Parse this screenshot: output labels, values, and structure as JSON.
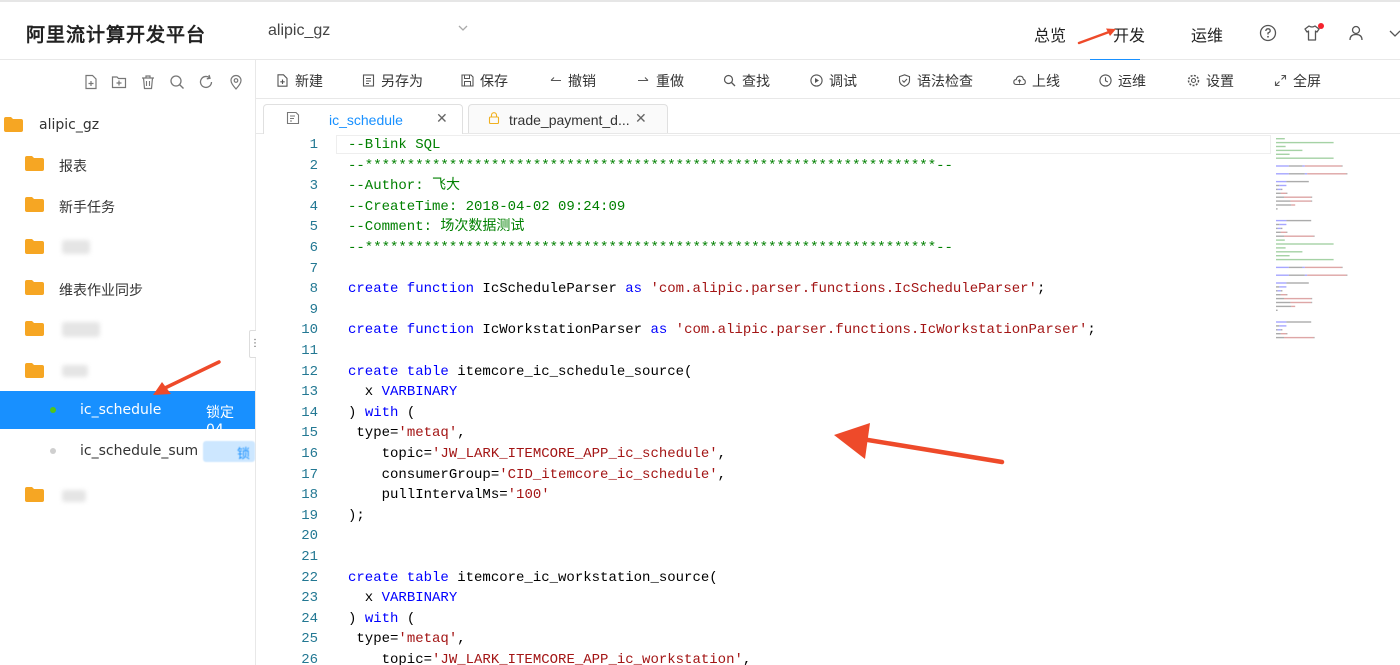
{
  "app": {
    "title": "阿里流计算开发平台"
  },
  "project": {
    "selected": "alipic_gz"
  },
  "topnav": {
    "items": [
      "总览",
      "开发",
      "运维"
    ],
    "active": "开发"
  },
  "sidebar": {
    "root": "alipic_gz",
    "items": [
      {
        "label": "报表"
      },
      {
        "label": "新手任务"
      },
      {
        "label": ""
      },
      {
        "label": "维表作业同步"
      },
      {
        "label": ""
      },
      {
        "label": ""
      }
    ],
    "jobs": [
      {
        "label": "ic_schedule",
        "lock": "锁定 04",
        "status_color": "#52c41a"
      },
      {
        "label": "ic_schedule_sum",
        "lock": "锁",
        "status_color": "#cfcfcf"
      }
    ]
  },
  "toolbar": {
    "new": "新建",
    "save_as": "另存为",
    "save": "保存",
    "undo": "撤销",
    "redo": "重做",
    "find": "查找",
    "debug": "调试",
    "syntax_check": "语法检查",
    "publish": "上线",
    "ops": "运维",
    "settings": "设置",
    "fullscreen": "全屏"
  },
  "tabs": [
    {
      "label": "ic_schedule",
      "active": true
    },
    {
      "label": "trade_payment_d...",
      "active": false
    }
  ],
  "colors": {
    "accent": "#1890ff",
    "comment": "#008000",
    "keyword": "#0000ff",
    "string": "#a31515",
    "arrow": "#ee4a2a"
  },
  "code_lines": [
    {
      "n": "1",
      "segments": [
        {
          "t": "--Blink SQL",
          "c": "com"
        }
      ]
    },
    {
      "n": "2",
      "segments": [
        {
          "t": "--********************************************************************--",
          "c": "com"
        }
      ]
    },
    {
      "n": "3",
      "segments": [
        {
          "t": "--Author: 飞大",
          "c": "com"
        }
      ]
    },
    {
      "n": "4",
      "segments": [
        {
          "t": "--CreateTime: 2018-04-02 09:24:09",
          "c": "com"
        }
      ]
    },
    {
      "n": "5",
      "segments": [
        {
          "t": "--Comment: 场次数据测试",
          "c": "com"
        }
      ]
    },
    {
      "n": "6",
      "segments": [
        {
          "t": "--********************************************************************--",
          "c": "com"
        }
      ]
    },
    {
      "n": "7",
      "segments": []
    },
    {
      "n": "8",
      "segments": [
        {
          "t": "create function ",
          "c": "kw"
        },
        {
          "t": "IcScheduleParser ",
          "c": "plain"
        },
        {
          "t": "as ",
          "c": "kw"
        },
        {
          "t": "'com.alipic.parser.functions.IcScheduleParser'",
          "c": "str"
        },
        {
          "t": ";",
          "c": "plain"
        }
      ]
    },
    {
      "n": "9",
      "segments": []
    },
    {
      "n": "10",
      "segments": [
        {
          "t": "create function ",
          "c": "kw"
        },
        {
          "t": "IcWorkstationParser ",
          "c": "plain"
        },
        {
          "t": "as ",
          "c": "kw"
        },
        {
          "t": "'com.alipic.parser.functions.IcWorkstationParser'",
          "c": "str"
        },
        {
          "t": ";",
          "c": "plain"
        }
      ]
    },
    {
      "n": "11",
      "segments": []
    },
    {
      "n": "12",
      "segments": [
        {
          "t": "create table ",
          "c": "kw"
        },
        {
          "t": "itemcore_ic_schedule_source(",
          "c": "plain"
        }
      ]
    },
    {
      "n": "13",
      "segments": [
        {
          "t": "  x ",
          "c": "plain"
        },
        {
          "t": "VARBINARY",
          "c": "kw"
        }
      ]
    },
    {
      "n": "14",
      "segments": [
        {
          "t": ") ",
          "c": "plain"
        },
        {
          "t": "with",
          "c": "kw"
        },
        {
          "t": " (",
          "c": "plain"
        }
      ]
    },
    {
      "n": "15",
      "segments": [
        {
          "t": " type=",
          "c": "plain"
        },
        {
          "t": "'metaq'",
          "c": "str"
        },
        {
          "t": ",",
          "c": "plain"
        }
      ]
    },
    {
      "n": "16",
      "segments": [
        {
          "t": "    topic=",
          "c": "plain"
        },
        {
          "t": "'JW_LARK_ITEMCORE_APP_ic_schedule'",
          "c": "str"
        },
        {
          "t": ",",
          "c": "plain"
        }
      ]
    },
    {
      "n": "17",
      "segments": [
        {
          "t": "    consumerGroup=",
          "c": "plain"
        },
        {
          "t": "'CID_itemcore_ic_schedule'",
          "c": "str"
        },
        {
          "t": ",",
          "c": "plain"
        }
      ]
    },
    {
      "n": "18",
      "segments": [
        {
          "t": "    pullIntervalMs=",
          "c": "plain"
        },
        {
          "t": "'100'",
          "c": "str"
        }
      ]
    },
    {
      "n": "19",
      "segments": [
        {
          "t": ");",
          "c": "plain"
        }
      ]
    },
    {
      "n": "20",
      "segments": []
    },
    {
      "n": "21",
      "segments": []
    },
    {
      "n": "22",
      "segments": [
        {
          "t": "create table ",
          "c": "kw"
        },
        {
          "t": "itemcore_ic_workstation_source(",
          "c": "plain"
        }
      ]
    },
    {
      "n": "23",
      "segments": [
        {
          "t": "  x ",
          "c": "plain"
        },
        {
          "t": "VARBINARY",
          "c": "kw"
        }
      ]
    },
    {
      "n": "24",
      "segments": [
        {
          "t": ") ",
          "c": "plain"
        },
        {
          "t": "with",
          "c": "kw"
        },
        {
          "t": " (",
          "c": "plain"
        }
      ]
    },
    {
      "n": "25",
      "segments": [
        {
          "t": " type=",
          "c": "plain"
        },
        {
          "t": "'metaq'",
          "c": "str"
        },
        {
          "t": ",",
          "c": "plain"
        }
      ]
    },
    {
      "n": "26",
      "segments": [
        {
          "t": "    topic=",
          "c": "plain"
        },
        {
          "t": "'JW_LARK_ITEMCORE_APP_ic_workstation'",
          "c": "str"
        },
        {
          "t": ",",
          "c": "plain"
        }
      ]
    }
  ]
}
